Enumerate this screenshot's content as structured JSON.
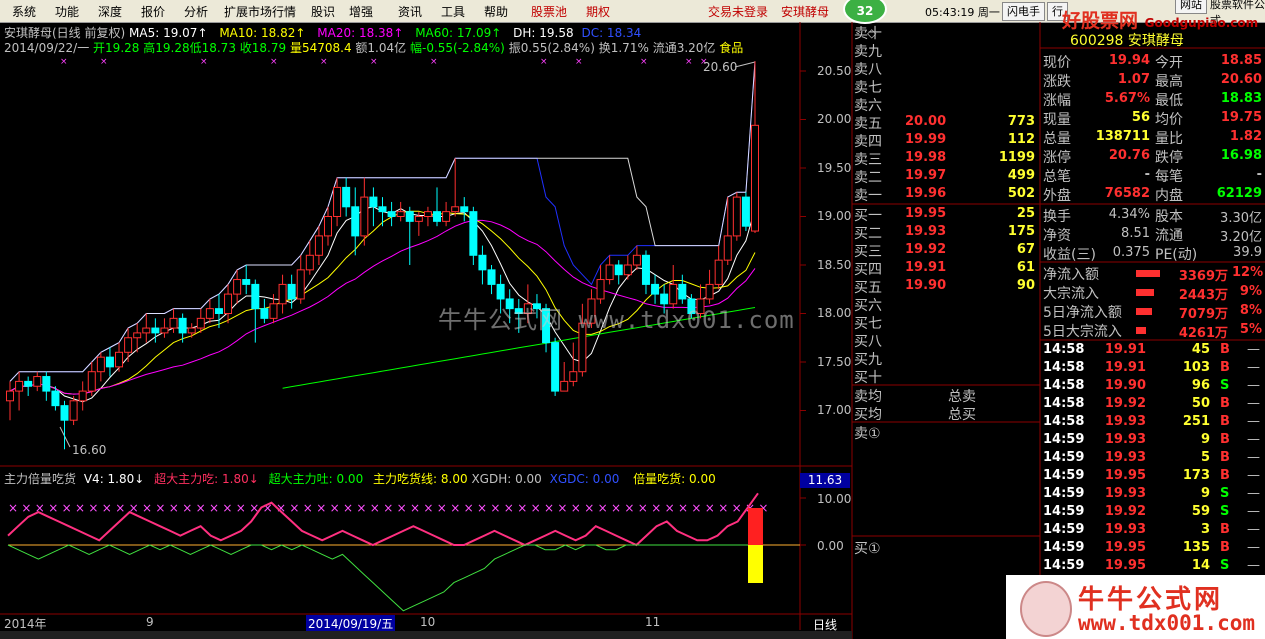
{
  "menu": {
    "items": [
      "系统",
      "功能",
      "深度",
      "报价",
      "分析",
      "扩展市场行情",
      "股识",
      "增强",
      "资讯",
      "工具",
      "帮助"
    ],
    "red_items": [
      "股票池",
      "期权"
    ],
    "login": "交易未登录",
    "stock_link": "安琪酵母",
    "badge": "32",
    "clock": "05:43:19 周一",
    "buttons": [
      "闪电手",
      "行"
    ],
    "website_label": "网站",
    "software_label": "股票软件公式"
  },
  "logo": {
    "text": "好股票网",
    "url": "Goodgupiao.com"
  },
  "chart": {
    "title": "安琪酵母(日线 前复权)",
    "ma5": "MA5: 19.07",
    "ma10": "MA10: 18.82",
    "ma20": "MA20: 18.38",
    "ma60": "MA60: 17.09",
    "dh": "DH: 19.58",
    "dc": "DC: 18.34",
    "ohlc_date": "2014/09/22/一",
    "ohlc_open": "开19.28",
    "ohlc_high": "高19.28",
    "ohlc_low": "低18.73",
    "ohlc_close": "收18.79",
    "ohlc_vol": "量54708.4",
    "ohlc_amount": "额1.04亿",
    "ohlc_change": "幅-0.55(-2.84%)",
    "ohlc_amp": "振0.55(2.84%)",
    "ohlc_turn": "换1.71%",
    "ohlc_float": "流通3.20亿",
    "ohlc_sector": "食品",
    "high_mark": "20.60",
    "low_mark": "16.60",
    "watermark": "牛牛公式网 www.tdx001.com",
    "y_labels": [
      "20.50",
      "20.00",
      "19.50",
      "19.00",
      "18.50",
      "18.00",
      "17.50",
      "17.00"
    ],
    "x_labels": [
      "2014年",
      "9",
      "2014/09/19/五",
      "10",
      "11"
    ],
    "right_tab": "日线",
    "colors": {
      "up": "#ff3030",
      "down": "#00ffff",
      "ma5": "#ffffff",
      "ma10": "#ffff00",
      "ma20": "#ff00ff",
      "ma60": "#00ff00",
      "dh": "#0000ff"
    }
  },
  "indicator": {
    "name": "主力倍量吃货",
    "v4": "V4: 1.80",
    "super_eat": "超大主力吃: 1.80",
    "super_spit": "超大主力吐: 0.00",
    "main_eat": "主力吃货线: 8.00",
    "xgdh": "XGDH: 0.00",
    "xgdc": "XGDC: 0.00",
    "double_eat": "倍量吃货: 0.00",
    "current": "11.63",
    "y_labels": [
      "10.00",
      "0.00"
    ]
  },
  "orderbook": {
    "sell": [
      {
        "label": "卖十",
        "price": "",
        "vol": ""
      },
      {
        "label": "卖九",
        "price": "",
        "vol": ""
      },
      {
        "label": "卖八",
        "price": "",
        "vol": ""
      },
      {
        "label": "卖七",
        "price": "",
        "vol": ""
      },
      {
        "label": "卖六",
        "price": "",
        "vol": ""
      },
      {
        "label": "卖五",
        "price": "20.00",
        "vol": "773"
      },
      {
        "label": "卖四",
        "price": "19.99",
        "vol": "112"
      },
      {
        "label": "卖三",
        "price": "19.98",
        "vol": "1199"
      },
      {
        "label": "卖二",
        "price": "19.97",
        "vol": "499"
      },
      {
        "label": "卖一",
        "price": "19.96",
        "vol": "502"
      }
    ],
    "buy": [
      {
        "label": "买一",
        "price": "19.95",
        "vol": "25"
      },
      {
        "label": "买二",
        "price": "19.93",
        "vol": "175"
      },
      {
        "label": "买三",
        "price": "19.92",
        "vol": "67"
      },
      {
        "label": "买四",
        "price": "19.91",
        "vol": "61"
      },
      {
        "label": "买五",
        "price": "19.90",
        "vol": "90"
      },
      {
        "label": "买六",
        "price": "",
        "vol": ""
      },
      {
        "label": "买七",
        "price": "",
        "vol": ""
      },
      {
        "label": "买八",
        "price": "",
        "vol": ""
      },
      {
        "label": "买九",
        "price": "",
        "vol": ""
      },
      {
        "label": "买十",
        "price": "",
        "vol": ""
      }
    ],
    "sell_avg": "卖均",
    "buy_avg": "买均",
    "total_sell": "总卖",
    "total_buy": "总买",
    "sell_q": "卖①",
    "buy_q": "买①"
  },
  "quote": {
    "code_name": "600298 安琪酵母",
    "rows": [
      {
        "l1": "现价",
        "v1": "19.94",
        "c1": "#ff3030",
        "l2": "今开",
        "v2": "18.85",
        "c2": "#ff3030"
      },
      {
        "l1": "涨跌",
        "v1": "1.07",
        "c1": "#ff3030",
        "l2": "最高",
        "v2": "20.60",
        "c2": "#ff3030"
      },
      {
        "l1": "涨幅",
        "v1": "5.67%",
        "c1": "#ff3030",
        "l2": "最低",
        "v2": "18.83",
        "c2": "#00ff00"
      },
      {
        "l1": "现量",
        "v1": "56",
        "c1": "#ffff30",
        "l2": "均价",
        "v2": "19.75",
        "c2": "#ff3030"
      },
      {
        "l1": "总量",
        "v1": "138711",
        "c1": "#ffff30",
        "l2": "量比",
        "v2": "1.82",
        "c2": "#ff3030"
      },
      {
        "l1": "涨停",
        "v1": "20.76",
        "c1": "#ff3030",
        "l2": "跌停",
        "v2": "16.98",
        "c2": "#00ff00"
      },
      {
        "l1": "总笔",
        "v1": "-",
        "c1": "#c0c0c0",
        "l2": "每笔",
        "v2": "-",
        "c2": "#c0c0c0"
      },
      {
        "l1": "外盘",
        "v1": "76582",
        "c1": "#ff3030",
        "l2": "内盘",
        "v2": "62129",
        "c2": "#00ff00"
      }
    ],
    "rows2": [
      {
        "l1": "换手",
        "v1": "4.34%",
        "l2": "股本",
        "v2": "3.30亿"
      },
      {
        "l1": "净资",
        "v1": "8.51",
        "l2": "流通",
        "v2": "3.20亿"
      },
      {
        "l1": "收益(三)",
        "v1": "0.375",
        "l2": "PE(动)",
        "v2": "39.9"
      }
    ],
    "flows": [
      {
        "label": "净流入额",
        "value": "3369万",
        "pct": "12%",
        "bar": 0.12
      },
      {
        "label": "大宗流入",
        "value": "2443万",
        "pct": "9%",
        "bar": 0.09
      },
      {
        "label": "5日净流入额",
        "value": "7079万",
        "pct": "8%",
        "bar": 0.08
      },
      {
        "label": "5日大宗流入",
        "value": "4261万",
        "pct": "5%",
        "bar": 0.05
      }
    ],
    "ticks": [
      {
        "t": "14:58",
        "p": "19.91",
        "v": "45",
        "s": "B"
      },
      {
        "t": "14:58",
        "p": "19.91",
        "v": "103",
        "s": "B"
      },
      {
        "t": "14:58",
        "p": "19.90",
        "v": "96",
        "s": "S"
      },
      {
        "t": "14:58",
        "p": "19.92",
        "v": "50",
        "s": "B"
      },
      {
        "t": "14:58",
        "p": "19.93",
        "v": "251",
        "s": "B"
      },
      {
        "t": "14:59",
        "p": "19.93",
        "v": "9",
        "s": "B"
      },
      {
        "t": "14:59",
        "p": "19.93",
        "v": "5",
        "s": "B"
      },
      {
        "t": "14:59",
        "p": "19.95",
        "v": "173",
        "s": "B"
      },
      {
        "t": "14:59",
        "p": "19.93",
        "v": "9",
        "s": "S"
      },
      {
        "t": "14:59",
        "p": "19.92",
        "v": "59",
        "s": "S"
      },
      {
        "t": "14:59",
        "p": "19.93",
        "v": "3",
        "s": "B"
      },
      {
        "t": "14:59",
        "p": "19.95",
        "v": "135",
        "s": "B"
      },
      {
        "t": "14:59",
        "p": "19.95",
        "v": "14",
        "s": "S"
      }
    ]
  },
  "brand": {
    "title": "牛牛公式网",
    "url": "www.tdx001.com"
  }
}
